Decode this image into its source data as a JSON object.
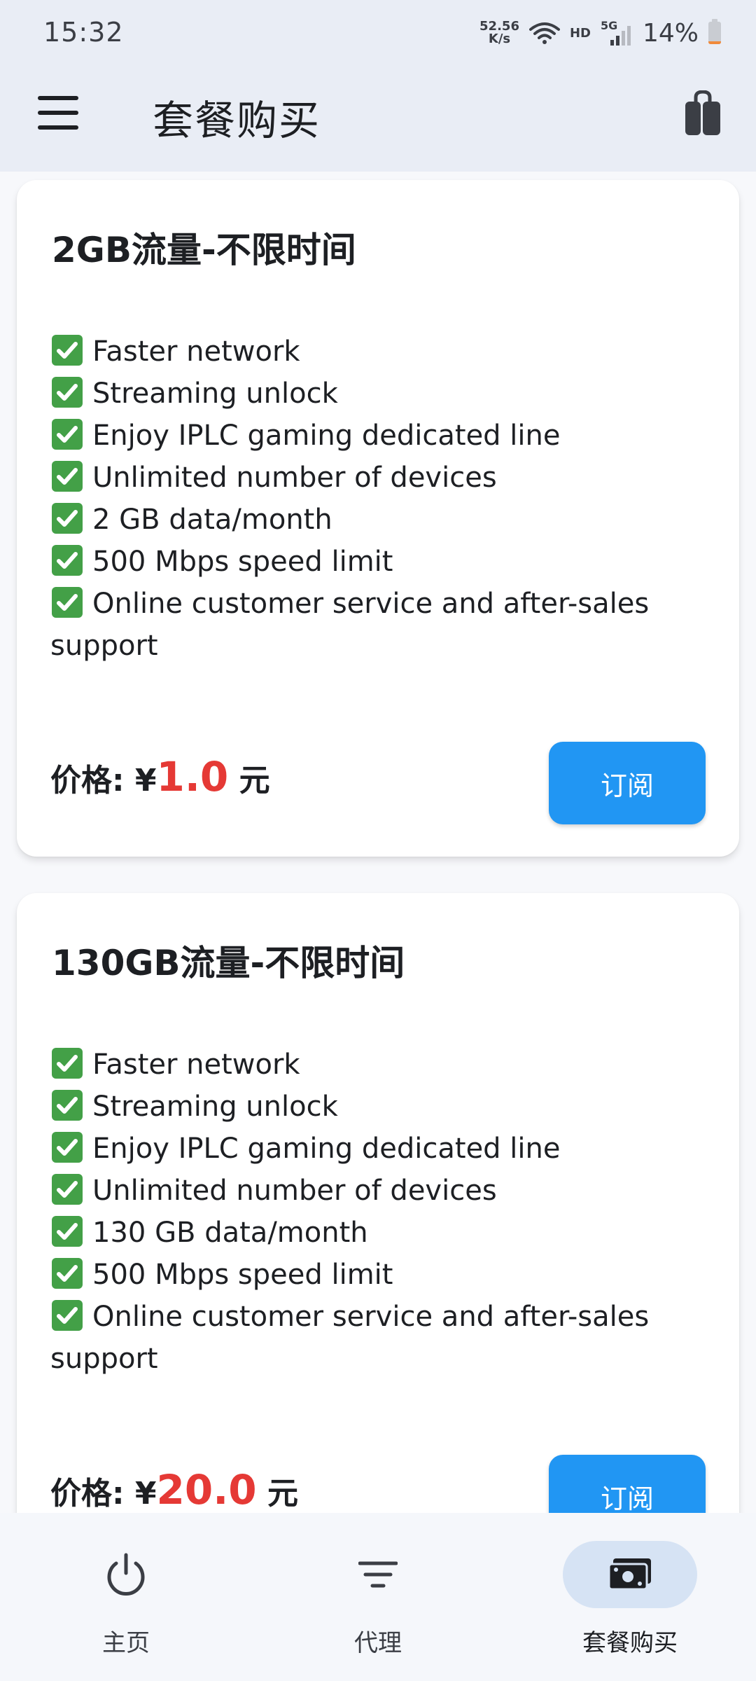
{
  "status_bar": {
    "time": "15:32",
    "net_speed_value": "52.56",
    "net_speed_unit": "K/s",
    "hd": "HD",
    "five_g": "5G",
    "battery": "14%",
    "battery_level": 0.14
  },
  "app_bar": {
    "title": "套餐购买",
    "menu_icon": "menu-icon",
    "action_icon": "shopping-bag-icon"
  },
  "plans": [
    {
      "title": "2GB流量-不限时间",
      "features": [
        "Faster network",
        "Streaming unlock",
        "Enjoy IPLC gaming dedicated line",
        "Unlimited number of devices",
        "2 GB data/month",
        "500 Mbps speed limit",
        "Online customer service and after-sales support"
      ],
      "price_label": "价格: ¥",
      "price": "1.0",
      "price_unit": " 元",
      "button": "订阅"
    },
    {
      "title": "130GB流量-不限时间",
      "features": [
        "Faster network",
        "Streaming unlock",
        "Enjoy IPLC gaming dedicated line",
        "Unlimited number of devices",
        "130 GB data/month",
        "500 Mbps speed limit",
        "Online customer service and after-sales support"
      ],
      "price_label": "价格: ¥",
      "price": "20.0",
      "price_unit": " 元",
      "button": "订阅"
    }
  ],
  "bottom_nav": [
    {
      "label": "主页",
      "icon": "power-icon",
      "active": false
    },
    {
      "label": "代理",
      "icon": "filter-icon",
      "active": false
    },
    {
      "label": "套餐购买",
      "icon": "money-icon",
      "active": true
    }
  ],
  "colors": {
    "accent": "#2196f3",
    "price": "#e53935",
    "check": "#43a047",
    "nav_active_bg": "#d6e3f4",
    "header_bg": "#e9edf5"
  }
}
